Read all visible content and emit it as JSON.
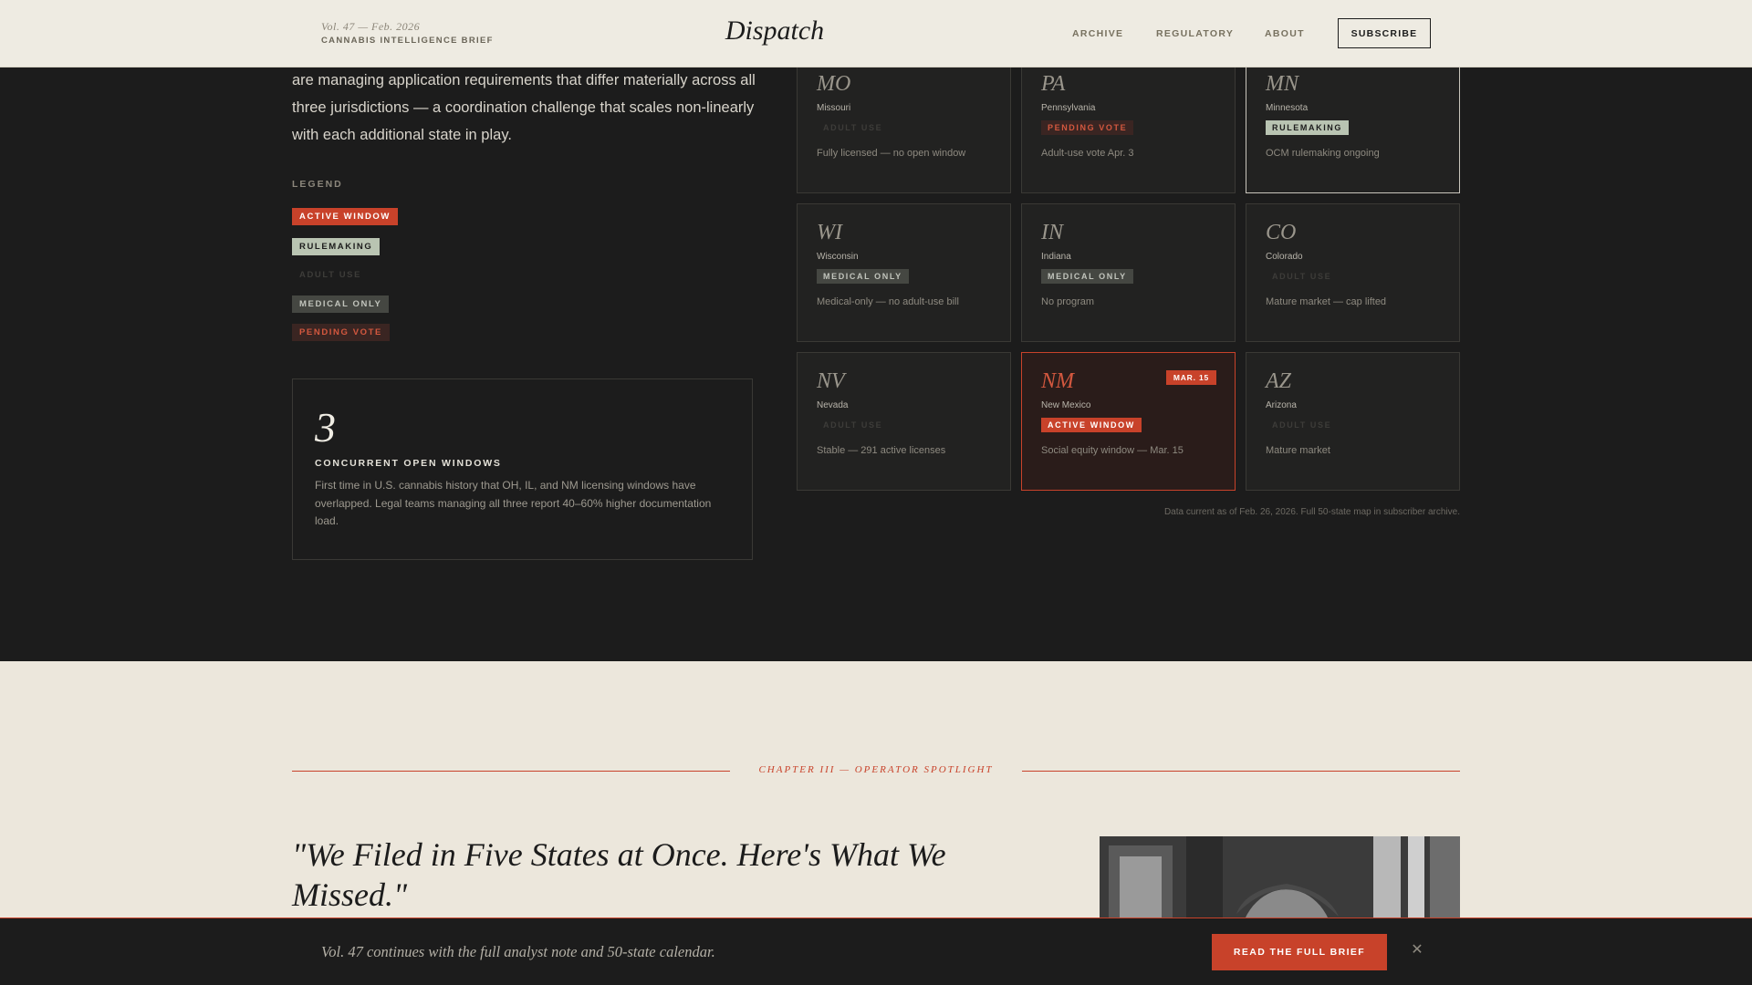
{
  "header": {
    "volume": "Vol. 47 — Feb. 2026",
    "brief_label": "CANNABIS INTELLIGENCE BRIEF",
    "logo": "Dispatch",
    "nav": [
      "ARCHIVE",
      "REGULATORY",
      "ABOUT"
    ],
    "subscribe_label": "SUBSCRIBE"
  },
  "intro": {
    "lines": [
      "are managing application requirements that differ materially across all",
      "three jurisdictions — a coordination challenge that scales non-linearly",
      "with each additional state in play."
    ]
  },
  "legend": {
    "title": "LEGEND",
    "items": [
      "ACTIVE WINDOW",
      "RULEMAKING",
      "ADULT USE",
      "MEDICAL ONLY",
      "PENDING VOTE"
    ]
  },
  "stat": {
    "number": "3",
    "label": "CONCURRENT OPEN WINDOWS",
    "text": "First time in U.S. cannabis history that OH, IL, and NM licensing windows have overlapped. Legal teams managing all three report 40–60% higher documentation load."
  },
  "states": [
    {
      "abbr": "MO",
      "name": "Missouri",
      "status": "ADULT USE",
      "note": "Fully licensed — no open window"
    },
    {
      "abbr": "PA",
      "name": "Pennsylvania",
      "status": "PENDING VOTE",
      "note": "Adult-use vote Apr. 3"
    },
    {
      "abbr": "MN",
      "name": "Minnesota",
      "status": "RULEMAKING",
      "note": "OCM rulemaking ongoing"
    },
    {
      "abbr": "WI",
      "name": "Wisconsin",
      "status": "MEDICAL ONLY",
      "note": "Medical-only — no adult-use bill"
    },
    {
      "abbr": "IN",
      "name": "Indiana",
      "status": "MEDICAL ONLY",
      "note": "No program"
    },
    {
      "abbr": "CO",
      "name": "Colorado",
      "status": "ADULT USE",
      "note": "Mature market — cap lifted"
    },
    {
      "abbr": "NV",
      "name": "Nevada",
      "status": "ADULT USE",
      "note": "Stable — 291 active licenses"
    },
    {
      "abbr": "NM",
      "name": "New Mexico",
      "status": "ACTIVE WINDOW",
      "note": "Social equity window — Mar. 15",
      "date_tag": "MAR. 15"
    },
    {
      "abbr": "AZ",
      "name": "Arizona",
      "status": "ADULT USE",
      "note": "Mature market"
    }
  ],
  "data_note": "Data current as of Feb. 26, 2026. Full 50-state map in subscriber archive.",
  "spotlight": {
    "chapter": "CHAPTER III — OPERATOR SPOTLIGHT",
    "quote": "\"We Filed in Five States at Once. Here's What We Missed.\""
  },
  "bottom_bar": {
    "text": "Vol. 47 continues with the full analyst note and 50-state calendar.",
    "cta": "READ THE FULL BRIEF",
    "close": "✕"
  },
  "colors": {
    "accent": "#c8422a",
    "dark_bg": "#1c1c1c",
    "light_bg": "#ece7dc",
    "rulemaking": "#b9c4b2",
    "medical": "#454742"
  }
}
